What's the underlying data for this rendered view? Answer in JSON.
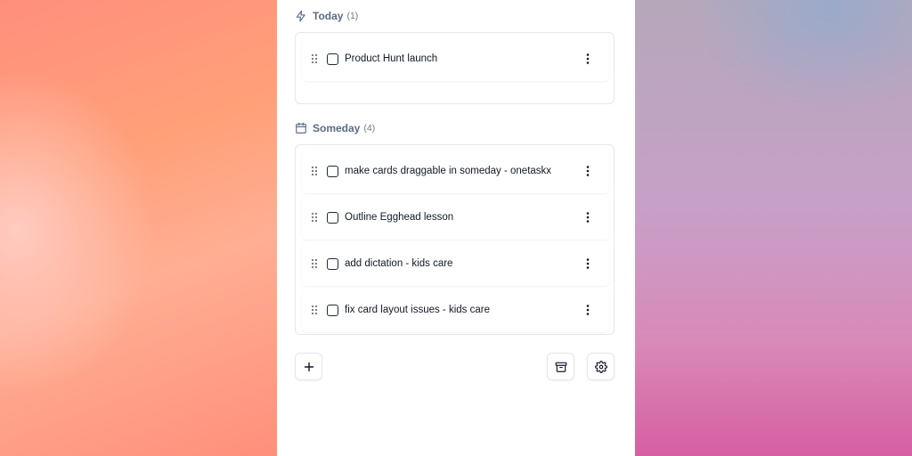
{
  "sections": {
    "today": {
      "title": "Today",
      "count": "(1)",
      "icon": "lightning-icon",
      "tasks": [
        {
          "label": "Product Hunt launch",
          "checked": false
        }
      ]
    },
    "someday": {
      "title": "Someday",
      "count": "(4)",
      "icon": "calendar-icon",
      "tasks": [
        {
          "label": "make cards draggable in someday - onetaskx",
          "checked": false
        },
        {
          "label": "Outline Egghead lesson",
          "checked": false
        },
        {
          "label": "add dictation - kids care",
          "checked": false
        },
        {
          "label": "fix card layout issues - kids care",
          "checked": false
        }
      ]
    }
  },
  "toolbar": {
    "add_icon": "plus-icon",
    "archive_icon": "archive-icon",
    "settings_icon": "gear-icon"
  },
  "colors": {
    "header_text": "#5b6b86",
    "task_text": "#111827",
    "border": "#e5e7eb"
  }
}
